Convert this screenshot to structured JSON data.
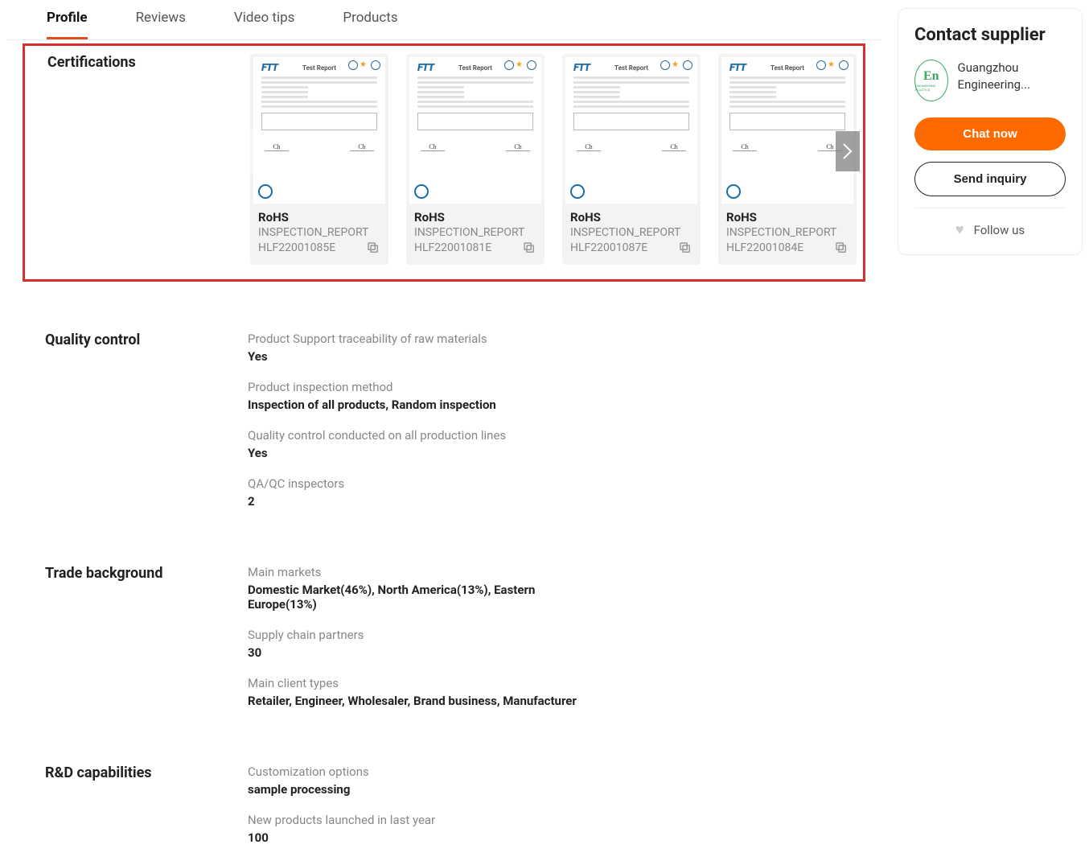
{
  "tabs": [
    {
      "label": "Profile",
      "active": true
    },
    {
      "label": "Reviews",
      "active": false
    },
    {
      "label": "Video tips",
      "active": false
    },
    {
      "label": "Products",
      "active": false
    }
  ],
  "sections": {
    "certifications": {
      "title": "Certifications",
      "items": [
        {
          "name": "RoHS",
          "file_line1": "INSPECTION_REPORT",
          "file_line2": "HLF22001085E"
        },
        {
          "name": "RoHS",
          "file_line1": "INSPECTION_REPORT",
          "file_line2": "HLF22001081E"
        },
        {
          "name": "RoHS",
          "file_line1": "INSPECTION_REPORT",
          "file_line2": "HLF22001087E"
        },
        {
          "name": "RoHS",
          "file_line1": "INSPECTION_REPORT",
          "file_line2": "HLF22001084E"
        }
      ],
      "report_title": "Test Report"
    },
    "quality": {
      "title": "Quality control",
      "kvs": [
        {
          "label": "Product Support traceability of raw materials",
          "value": "Yes"
        },
        {
          "label": "Product inspection method",
          "value": "Inspection of all products, Random inspection"
        },
        {
          "label": "Quality control conducted on all production lines",
          "value": "Yes"
        },
        {
          "label": "QA/QC inspectors",
          "value": "2"
        }
      ]
    },
    "trade": {
      "title": "Trade background",
      "kvs": [
        {
          "label": "Main markets",
          "value": "Domestic Market(46%), North America(13%), Eastern Europe(13%)"
        },
        {
          "label": "Supply chain partners",
          "value": "30"
        },
        {
          "label": "Main client types",
          "value": "Retailer, Engineer, Wholesaler, Brand business, Manufacturer",
          "full": true
        }
      ]
    },
    "rnd": {
      "title": "R&D capabilities",
      "kvs": [
        {
          "label": "Customization options",
          "value": "sample processing"
        },
        {
          "label": "New products launched in last year",
          "value": "100"
        }
      ]
    }
  },
  "contact": {
    "title": "Contact supplier",
    "supplier_name": "Guangzhou Engineering...",
    "logo_text": "En",
    "logo_sub": "ENGINEERING PLASTICS",
    "chat_label": "Chat now",
    "inquiry_label": "Send inquiry",
    "follow_label": "Follow us"
  }
}
